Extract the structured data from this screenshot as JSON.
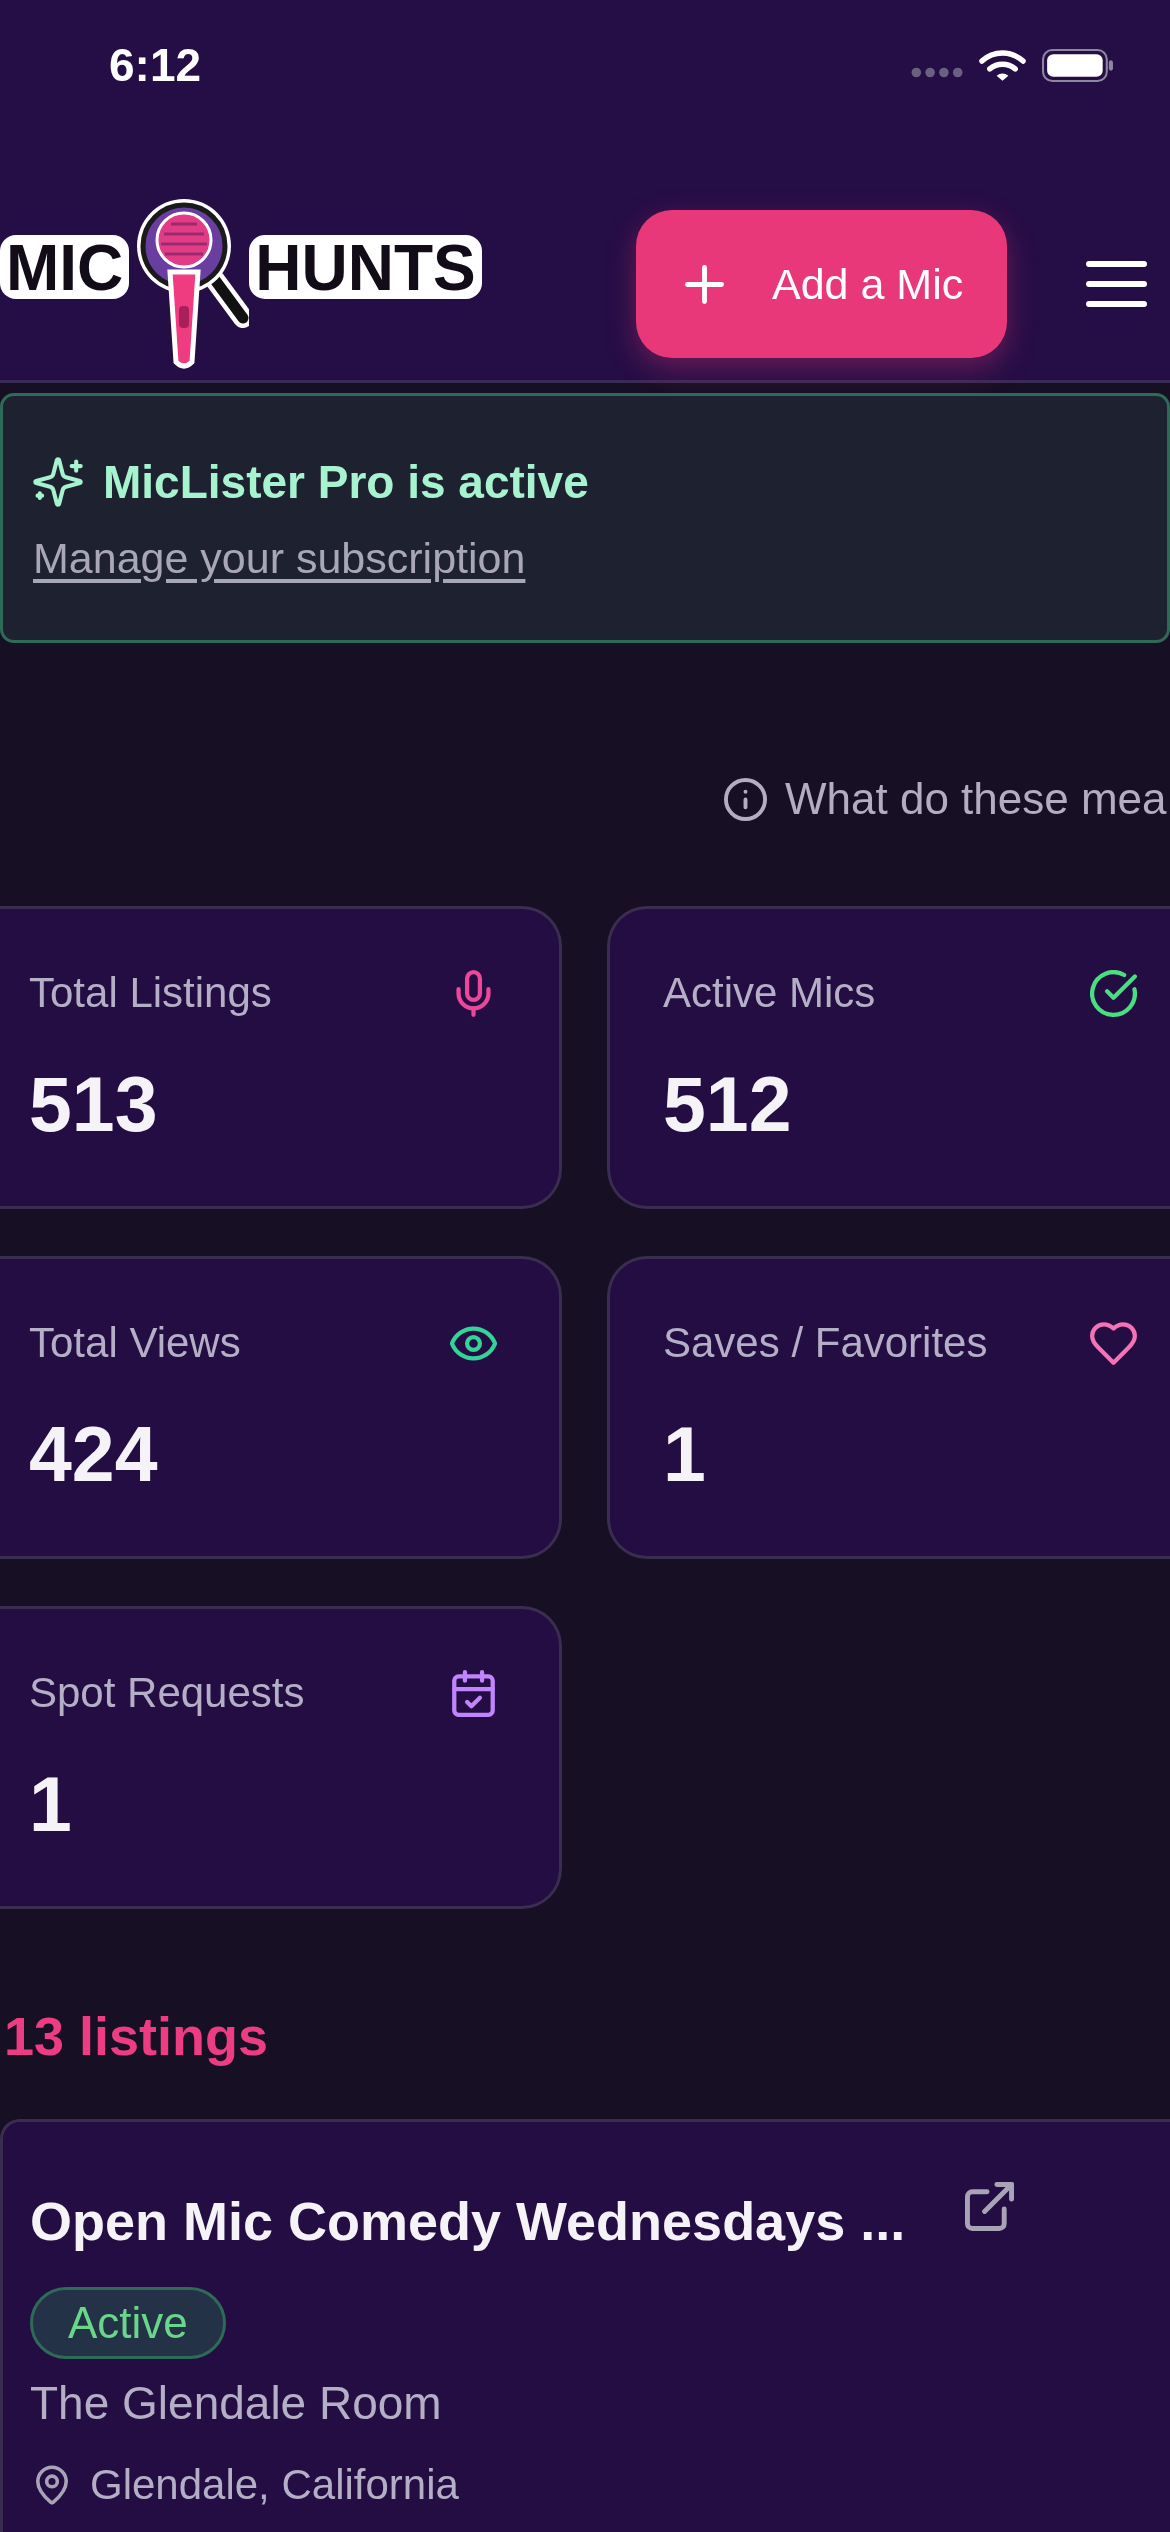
{
  "status_bar": {
    "time": "6:12"
  },
  "header": {
    "logo": {
      "left_text": "MIC",
      "right_text": "HUNTS"
    },
    "add_button": {
      "label": "Add a Mic"
    }
  },
  "pro_banner": {
    "title": "MicLister Pro is active",
    "link": "Manage your subscription"
  },
  "help_link": {
    "label": "What do these mea"
  },
  "stats": [
    {
      "kind": "mic",
      "label": "Total Listings",
      "value": "513",
      "color": "#ec4899"
    },
    {
      "kind": "check",
      "label": "Active Mics",
      "value": "512",
      "color": "#4ade80"
    },
    {
      "kind": "eye",
      "label": "Total Views",
      "value": "424",
      "color": "#34d399"
    },
    {
      "kind": "heart",
      "label": "Saves / Favorites",
      "value": "1",
      "color": "#f472b6"
    },
    {
      "kind": "calendar",
      "label": "Spot Requests",
      "value": "1",
      "color": "#c084fc"
    }
  ],
  "listings_count": "13 listings",
  "listings": [
    {
      "title": "Open Mic Comedy Wednesdays ...",
      "status": "Active",
      "venue": "The Glendale Room",
      "location": "Glendale, California"
    }
  ]
}
